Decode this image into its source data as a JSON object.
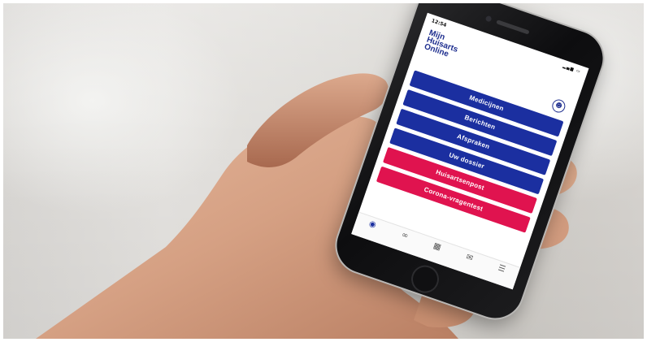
{
  "status_bar": {
    "time": "12:54"
  },
  "app": {
    "logo_lines": [
      "Mijn",
      "Huisarts",
      "Online"
    ]
  },
  "menu": {
    "items": [
      {
        "label": "Medicijnen",
        "color": "#1b2fa0"
      },
      {
        "label": "Berichten",
        "color": "#1b2fa0"
      },
      {
        "label": "Afspraken",
        "color": "#1b2fa0"
      },
      {
        "label": "Uw dossier",
        "color": "#1b2fa0"
      },
      {
        "label": "Huisartsenpost",
        "color": "#e0134f"
      },
      {
        "label": "Corona-vragentest",
        "color": "#e0134f"
      }
    ]
  },
  "tabbar": {
    "tabs": [
      {
        "icon": "home-icon"
      },
      {
        "icon": "medicines-icon"
      },
      {
        "icon": "calendar-icon"
      },
      {
        "icon": "messages-icon"
      },
      {
        "icon": "menu-icon"
      }
    ]
  },
  "colors": {
    "brand_blue": "#1b2fa0",
    "brand_pink": "#e0134f",
    "skin": "#d9a789"
  }
}
